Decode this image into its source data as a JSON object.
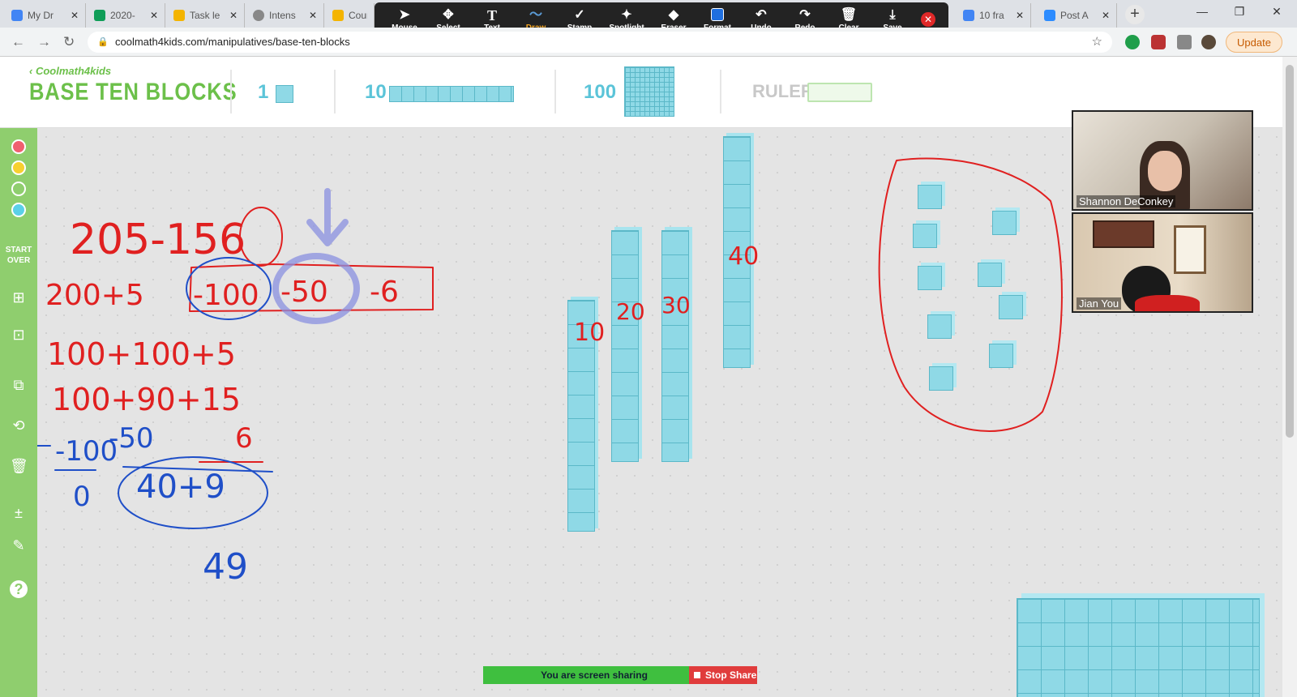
{
  "browser": {
    "tabs": [
      {
        "label": "My Dr",
        "color": "#4285f4"
      },
      {
        "label": "2020-",
        "color": "#0f9d58"
      },
      {
        "label": "Task le",
        "color": "#f4b400"
      },
      {
        "label": "Intens",
        "color": "#888888"
      },
      {
        "label": "Cour",
        "color": "#f4b400"
      },
      {
        "label": "10 fra",
        "color": "#4285f4"
      },
      {
        "label": "Post A",
        "color": "#2d8cff"
      }
    ],
    "url": "coolmath4kids.com/manipulatives/base-ten-blocks",
    "update_label": "Update"
  },
  "zoom_toolbar": {
    "tools": [
      {
        "label": "Mouse",
        "icon": "cursor-icon"
      },
      {
        "label": "Select",
        "icon": "move-icon"
      },
      {
        "label": "Text",
        "icon": "text-icon"
      },
      {
        "label": "Draw",
        "icon": "draw-icon"
      },
      {
        "label": "Stamp",
        "icon": "stamp-icon"
      },
      {
        "label": "Spotlight",
        "icon": "spotlight-icon"
      },
      {
        "label": "Eraser",
        "icon": "eraser-icon"
      },
      {
        "label": "Format",
        "icon": "format-icon"
      },
      {
        "label": "Undo",
        "icon": "undo-icon"
      },
      {
        "label": "Redo",
        "icon": "redo-icon"
      },
      {
        "label": "Clear",
        "icon": "trash-icon"
      },
      {
        "label": "Save",
        "icon": "save-icon"
      }
    ],
    "active": "Draw"
  },
  "app": {
    "brand": "Coolmath4kids",
    "title": "BASE TEN BLOCKS",
    "block_one": "1",
    "block_ten": "10",
    "block_hundred": "100",
    "ruler": "RULER"
  },
  "sidebar": {
    "colors": [
      "#f06070",
      "#f7d030",
      "#8fce6e",
      "#5bd0e8"
    ],
    "start_over": "START OVER"
  },
  "annotations": {
    "line1": "205-156",
    "line2_a": "200+5",
    "line2_b": "-100",
    "line2_c": "-50",
    "line2_d": "-6",
    "line3": "100+100+5",
    "line4": "100+90+15",
    "line5_a": "-100",
    "line5_b": "-50",
    "line5_c": "6",
    "line6_a": "0",
    "line6_b": "40+9",
    "answer": "49",
    "rod_labels": [
      "10",
      "20",
      "30",
      "40"
    ]
  },
  "video": {
    "p1": "Shannon DeConkey",
    "p2": "Jian You"
  },
  "share": {
    "message": "You are screen sharing",
    "stop": "Stop Share"
  }
}
